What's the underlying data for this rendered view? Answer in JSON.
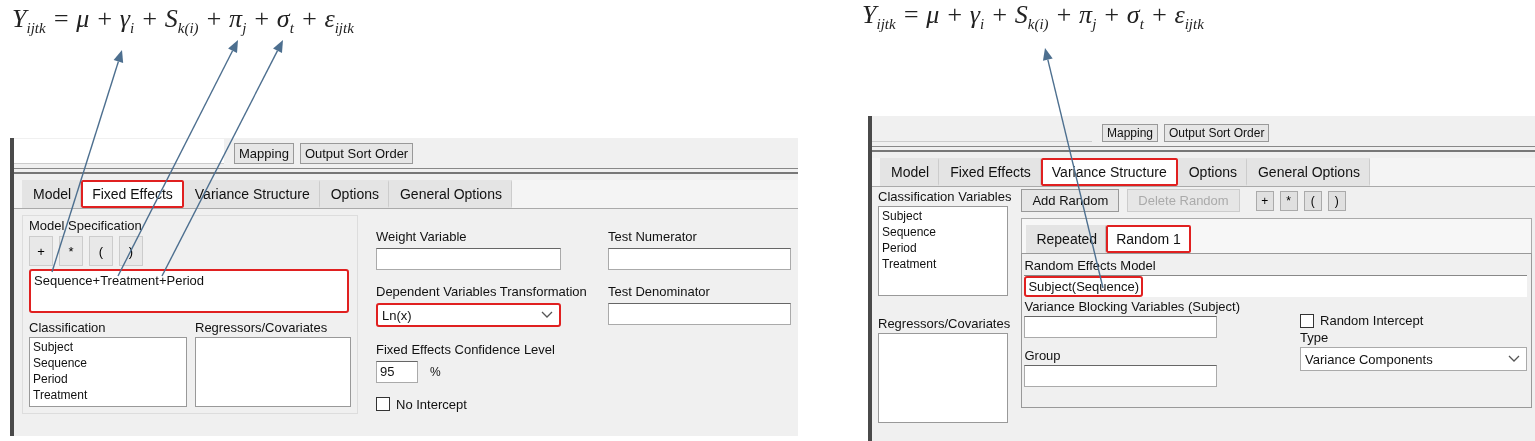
{
  "left_figure": {
    "formula": "Y$_{ijtk}$ = μ + γ$_{i}$ + S$_{k(i)}$ + π$_{j}$ + σ$_{t}$ + ε$_{ijtk}$",
    "top_buttons": [
      "Mapping",
      "Output Sort Order"
    ],
    "tabs": [
      {
        "label": "Model",
        "selected": false,
        "highlighted": false
      },
      {
        "label": "Fixed Effects",
        "selected": true,
        "highlighted": true
      },
      {
        "label": "Variance Structure",
        "selected": false,
        "highlighted": false
      },
      {
        "label": "Options",
        "selected": false,
        "highlighted": false
      },
      {
        "label": "General Options",
        "selected": false,
        "highlighted": false
      }
    ],
    "model_specification": {
      "title": "Model Specification",
      "operators": [
        "+",
        "*",
        "(",
        ")"
      ],
      "value": "Sequence+Treatment+Period",
      "highlighted": true
    },
    "classification": {
      "label": "Classification",
      "items": [
        "Subject",
        "Sequence",
        "Period",
        "Treatment"
      ]
    },
    "regressors": {
      "label": "Regressors/Covariates"
    },
    "weight_variable": {
      "label": "Weight Variable"
    },
    "test_numerator": {
      "label": "Test Numerator"
    },
    "transformation": {
      "label": "Dependent Variables Transformation",
      "value": "Ln(x)",
      "highlighted": true
    },
    "test_denominator": {
      "label": "Test Denominator"
    },
    "confidence": {
      "label": "Fixed Effects Confidence Level",
      "value": "95",
      "unit": "%"
    },
    "no_intercept": {
      "label": "No Intercept",
      "checked": false
    }
  },
  "right_figure": {
    "formula": "Y$_{ijtk}$ = μ + γ$_{i}$ + S$_{k(i)}$ + π$_{j}$ + σ$_{t}$ + ε$_{ijtk}$",
    "top_buttons": [
      "Mapping",
      "Output Sort Order"
    ],
    "tabs": [
      {
        "label": "Model",
        "selected": false,
        "highlighted": false
      },
      {
        "label": "Fixed Effects",
        "selected": false,
        "highlighted": false
      },
      {
        "label": "Variance Structure",
        "selected": true,
        "highlighted": true
      },
      {
        "label": "Options",
        "selected": false,
        "highlighted": false
      },
      {
        "label": "General Options",
        "selected": false,
        "highlighted": false
      }
    ],
    "classification_variables": {
      "label": "Classification Variables",
      "items": [
        "Subject",
        "Sequence",
        "Period",
        "Treatment"
      ]
    },
    "regressors": {
      "label": "Regressors/Covariates"
    },
    "random_buttons": [
      {
        "label": "Add Random",
        "disabled": false
      },
      {
        "label": "Delete Random",
        "disabled": true
      }
    ],
    "operators": [
      "+",
      "*",
      "(",
      ")"
    ],
    "subtabs": [
      {
        "label": "Repeated",
        "selected": false,
        "highlighted": false
      },
      {
        "label": "Random 1",
        "selected": true,
        "highlighted": true
      }
    ],
    "random_effects_model": {
      "label": "Random Effects Model",
      "value": "Subject(Sequence)",
      "highlighted": true
    },
    "blocking_variables": {
      "label": "Variance Blocking Variables (Subject)"
    },
    "group": {
      "label": "Group"
    },
    "random_intercept": {
      "label": "Random Intercept",
      "checked": false
    },
    "type": {
      "label": "Type",
      "value": "Variance Components"
    }
  }
}
